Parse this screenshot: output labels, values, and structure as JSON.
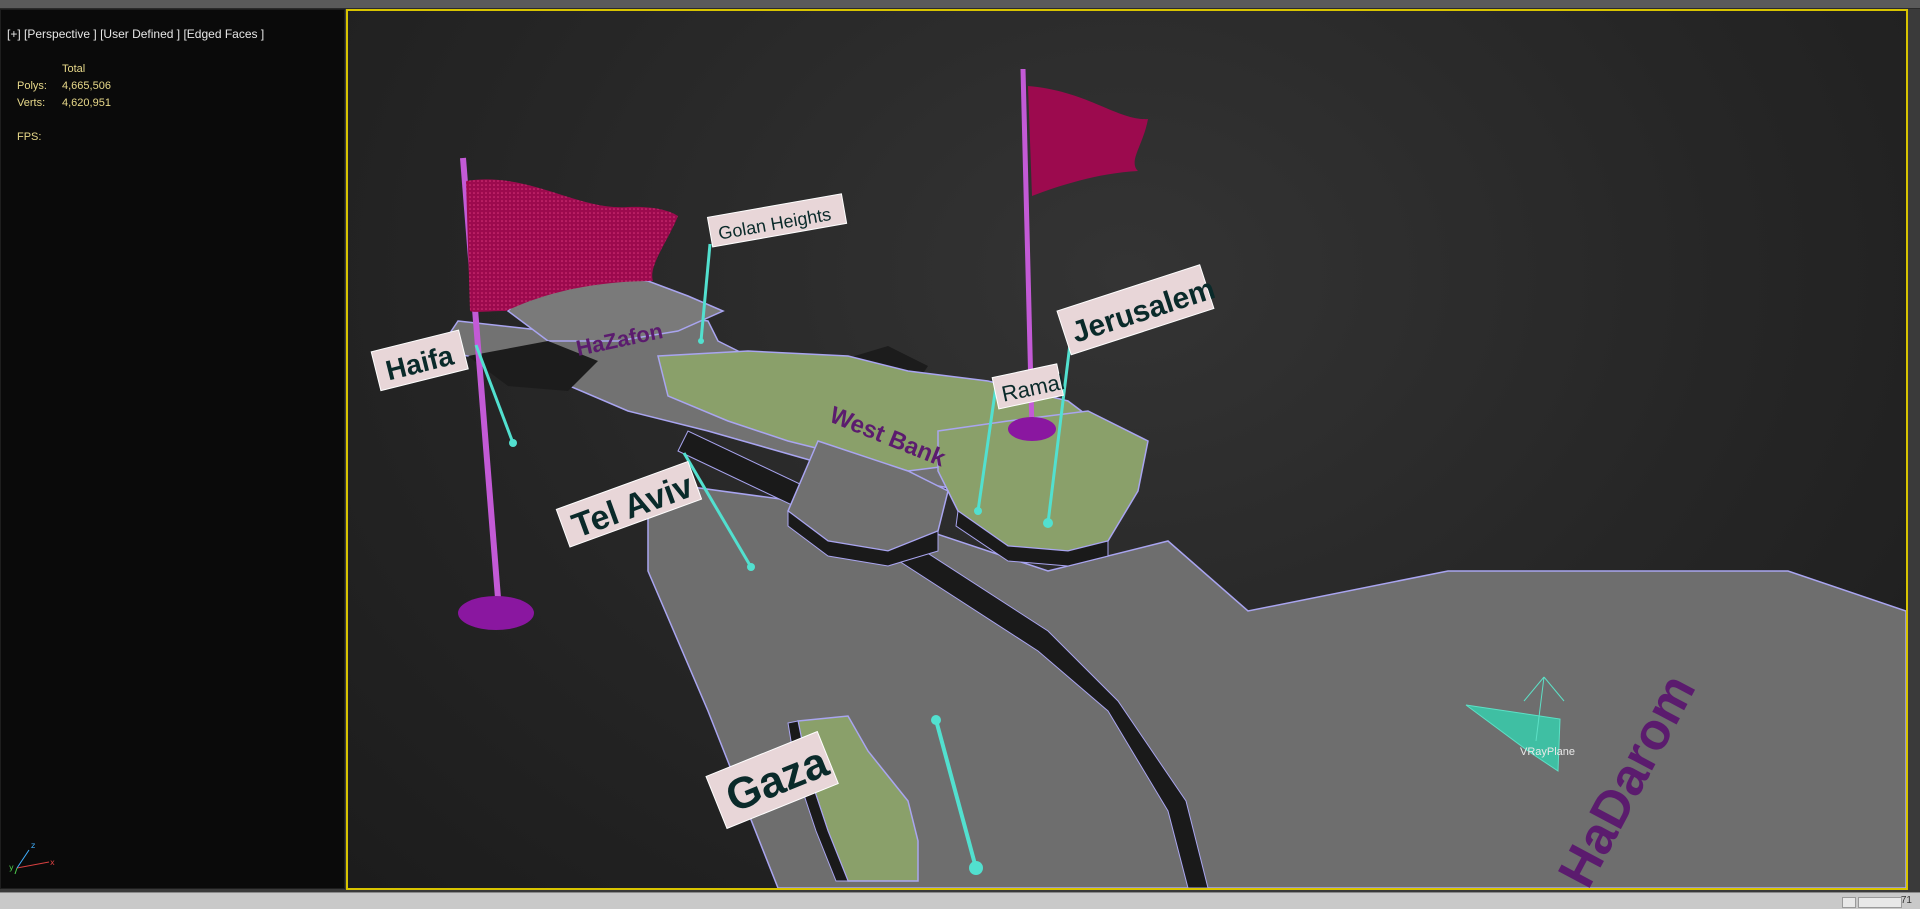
{
  "viewport_label": {
    "plus": "[+]",
    "view": "[Perspective ]",
    "mode": "[User Defined ]",
    "shading": "[Edged Faces ]"
  },
  "stats": {
    "header": "Total",
    "polys_label": "Polys:",
    "polys_value": "4,665,506",
    "verts_label": "Verts:",
    "verts_value": "4,620,951",
    "fps_label": "FPS:"
  },
  "map_labels": {
    "region_north": "HaZafon",
    "region_west_bank": "West Bank",
    "region_south": "HaDarom"
  },
  "city_labels": {
    "haifa": "Haifa",
    "golan": "Golan Heights",
    "tel_aviv": "Tel Aviv",
    "ramallah": "Ramal",
    "jerusalem": "Jerusalem",
    "gaza": "Gaza"
  },
  "scene_object_label": "VRayPlane",
  "status_zoom": "71",
  "colors": {
    "selection_border": "#d8c400",
    "flag": "#9c0a4e",
    "pole": "#c35ad6",
    "pin": "#52e0cf",
    "land_gray": "#6f6f6f",
    "land_green": "#8aa06a",
    "region_text": "#5b1b6e"
  }
}
